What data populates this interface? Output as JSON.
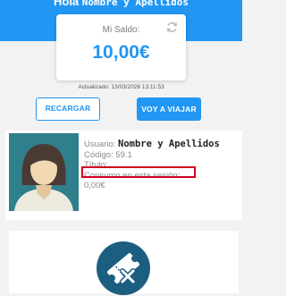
{
  "header": {
    "greeting": "Hola",
    "name": "Nombre y Apellidos"
  },
  "balance": {
    "label": "Mi Saldo:",
    "value": "10,00€",
    "refresh_icon": "refresh-icon",
    "updated": "Actualizado: 13/03/2026 13:11:53"
  },
  "actions": {
    "recargar": "RECARGAR",
    "viajar": "VOY A VIAJAR"
  },
  "profile": {
    "user_label": "Usuario:",
    "user_value": "Nombre y Apellidos",
    "code_label": "Código:",
    "code_value": "59.1",
    "title_label": "Título:",
    "consumption_label": "Consumo en esta sesión:",
    "consumption_value": "0,00€"
  },
  "ticket": {
    "icon": "ticket-cancel-icon"
  },
  "colors": {
    "primary": "#2196f3",
    "highlight": "#d3001f",
    "avatar_bg": "#2f7f8c"
  }
}
